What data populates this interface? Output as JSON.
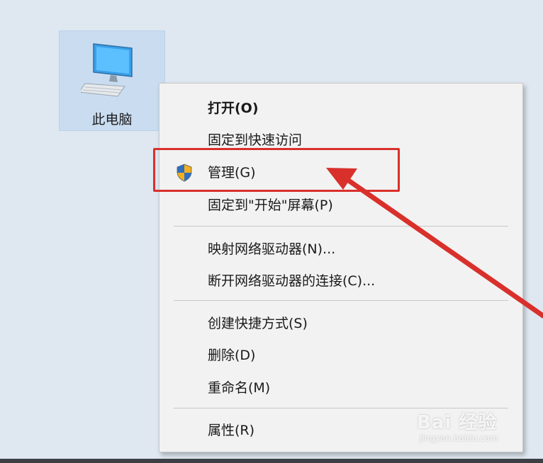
{
  "desktop": {
    "icon_label": "此电脑",
    "icon_name": "computer-icon"
  },
  "context_menu": {
    "items": [
      {
        "label": "打开(O)",
        "bold": true
      },
      {
        "label": "固定到快速访问"
      },
      {
        "label": "管理(G)",
        "icon": "uac-shield-icon"
      },
      {
        "label": "固定到\"开始\"屏幕(P)"
      },
      {
        "label": "映射网络驱动器(N)..."
      },
      {
        "label": "断开网络驱动器的连接(C)..."
      },
      {
        "label": "创建快捷方式(S)"
      },
      {
        "label": "删除(D)"
      },
      {
        "label": "重命名(M)"
      },
      {
        "label": "属性(R)"
      }
    ]
  },
  "annotation": {
    "highlight_color": "#d9302b",
    "arrow_color": "#d9302b"
  },
  "watermark": {
    "main": "Bai 经验",
    "sub": "jingyan.baidu.com"
  }
}
